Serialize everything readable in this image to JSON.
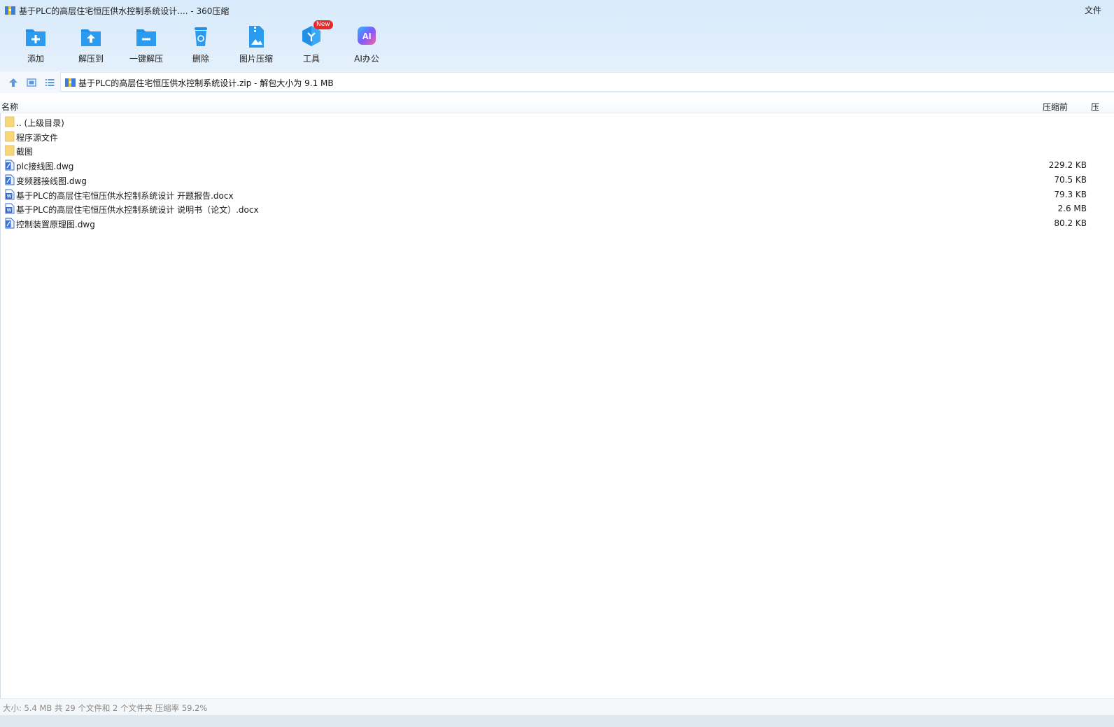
{
  "window": {
    "title": "基于PLC的高层住宅恒压供水控制系统设计.... - 360压缩",
    "title_right": "文件"
  },
  "toolbar": {
    "items": [
      {
        "label": "添加",
        "icon": "add-icon"
      },
      {
        "label": "解压到",
        "icon": "extract-to-icon"
      },
      {
        "label": "一键解压",
        "icon": "one-click-extract-icon"
      },
      {
        "label": "删除",
        "icon": "delete-icon"
      },
      {
        "label": "图片压缩",
        "icon": "image-compress-icon"
      },
      {
        "label": "工具",
        "icon": "tools-icon"
      },
      {
        "label": "AI办公",
        "icon": "ai-office-icon"
      }
    ],
    "new_badge": "New",
    "ai_icon_text": "AI"
  },
  "nav": {
    "path": "基于PLC的高层住宅恒压供水控制系统设计.zip - 解包大小为 9.1 MB"
  },
  "columns": {
    "name": "名称",
    "original_size": "压缩前",
    "compressed_size": "压"
  },
  "files": [
    {
      "name": ".. (上级目录)",
      "type": "folder",
      "size": ""
    },
    {
      "name": "程序源文件",
      "type": "folder",
      "size": ""
    },
    {
      "name": "截图",
      "type": "folder",
      "size": ""
    },
    {
      "name": "plc接线图.dwg",
      "type": "dwg",
      "size": "229.2 KB"
    },
    {
      "name": "变频器接线图.dwg",
      "type": "dwg",
      "size": "70.5 KB"
    },
    {
      "name": "基于PLC的高层住宅恒压供水控制系统设计 开题报告.docx",
      "type": "docx",
      "size": "79.3 KB"
    },
    {
      "name": "基于PLC的高层住宅恒压供水控制系统设计 说明书（论文）.docx",
      "type": "docx",
      "size": "2.6 MB"
    },
    {
      "name": "控制装置原理图.dwg",
      "type": "dwg",
      "size": "80.2 KB"
    }
  ],
  "status": {
    "text": "大小: 5.4 MB 共 29 个文件和 2 个文件夹 压缩率 59.2%"
  },
  "colors": {
    "accent": "#1f8fe8",
    "folder": "#f7d77a",
    "badge": "#e62a2a"
  }
}
